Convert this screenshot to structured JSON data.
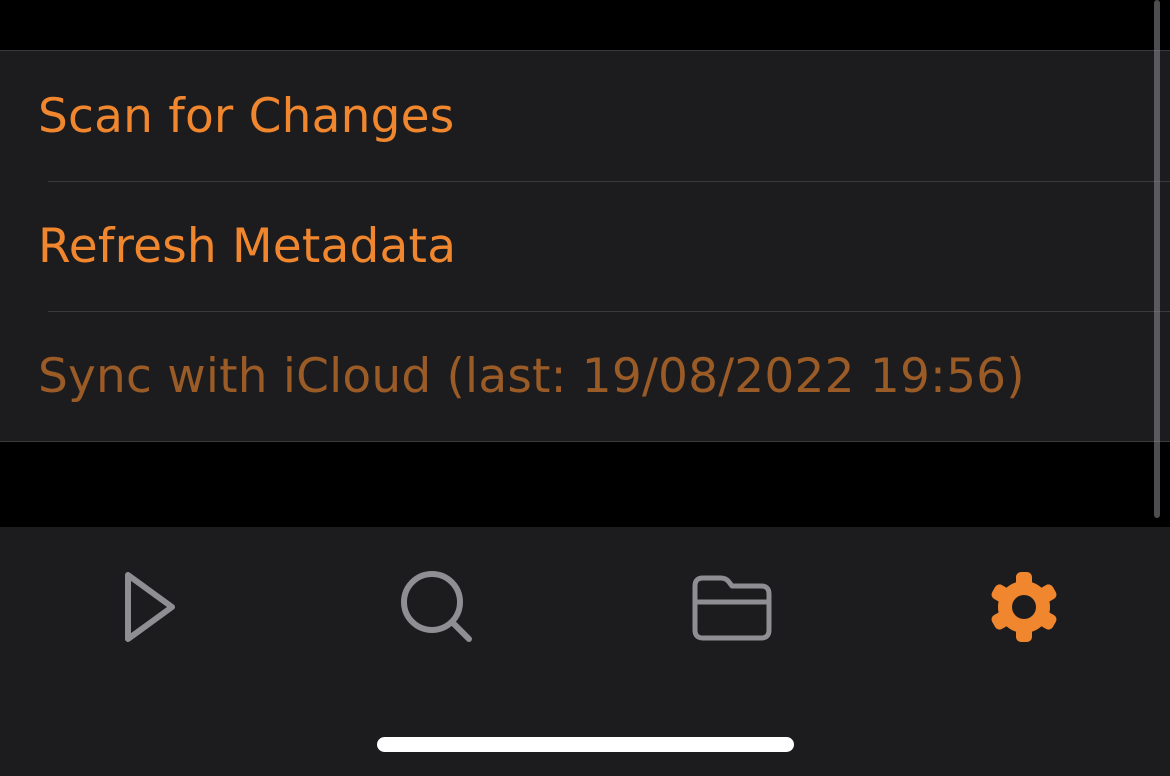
{
  "settings": {
    "rows": [
      {
        "label": "Scan for Changes",
        "enabled": true
      },
      {
        "label": "Refresh Metadata",
        "enabled": true
      },
      {
        "label": "Sync with iCloud (last: 19/08/2022 19:56)",
        "enabled": false
      }
    ]
  },
  "tab_bar": {
    "tabs": [
      {
        "name": "play",
        "icon": "play-icon",
        "selected": false
      },
      {
        "name": "search",
        "icon": "search-icon",
        "selected": false
      },
      {
        "name": "library",
        "icon": "folder-icon",
        "selected": false
      },
      {
        "name": "settings",
        "icon": "gear-icon",
        "selected": true
      }
    ]
  },
  "colors": {
    "accent": "#f0872f",
    "accent_disabled": "#9a5b27",
    "icon_inactive": "#8e8e93",
    "background": "#000000",
    "surface": "#1c1c1e",
    "separator": "#3a3a3c"
  }
}
